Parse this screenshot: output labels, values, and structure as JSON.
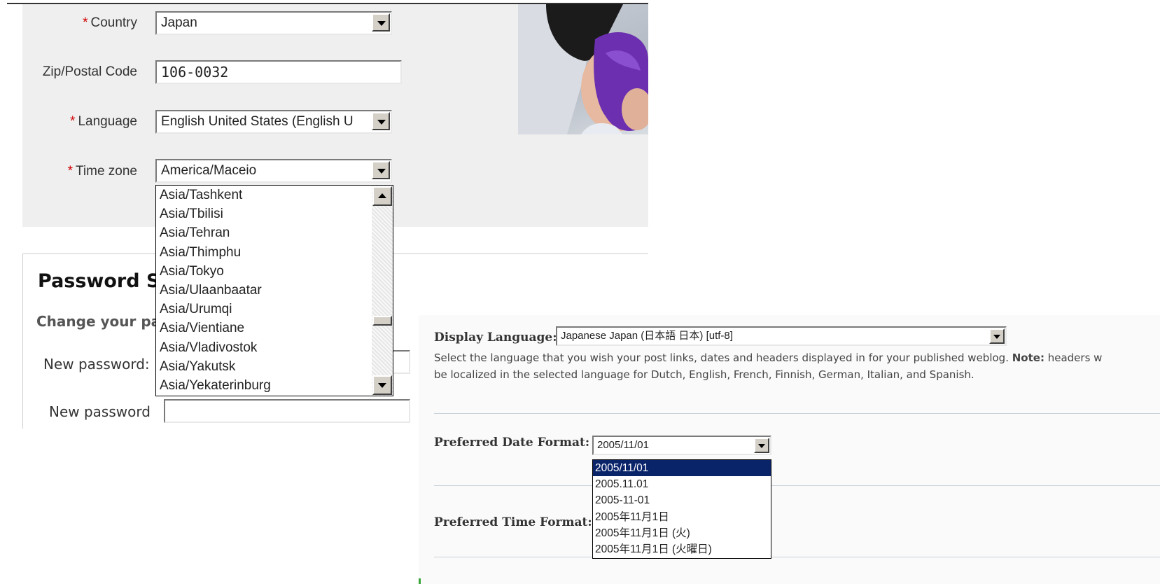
{
  "left": {
    "country": {
      "label": "Country",
      "value": "Japan"
    },
    "zip": {
      "label": "Zip/Postal Code",
      "value": "106-0032"
    },
    "language": {
      "label": "Language",
      "value": "English United States (English U"
    },
    "timezone": {
      "label": "Time zone",
      "value": "America/Maceio",
      "options": [
        "Asia/Tashkent",
        "Asia/Tbilisi",
        "Asia/Tehran",
        "Asia/Thimphu",
        "Asia/Tokyo",
        "Asia/Ulaanbaatar",
        "Asia/Urumqi",
        "Asia/Vientiane",
        "Asia/Vladivostok",
        "Asia/Yakutsk",
        "Asia/Yekaterinburg"
      ]
    },
    "required_mark": "*",
    "password": {
      "title": "Password Se",
      "subtitle": "Change your pa",
      "new_password_label": "New password:",
      "confirm_label": "New password"
    }
  },
  "right": {
    "display_language": {
      "label": "Display Language:",
      "value": "Japanese Japan (日本語 日本) [utf-8]",
      "help_1": "Select the language that you wish your post links, dates and headers displayed in for your published weblog.",
      "note_label": "Note:",
      "help_1b": "headers w",
      "help_2": "be localized in the selected language for Dutch, English, French, Finnish, German, Italian, and Spanish."
    },
    "date_format": {
      "label": "Preferred Date Format:",
      "value": "2005/11/01",
      "options": [
        "2005/11/01",
        "2005.11.01",
        "2005-11-01",
        "2005年11月1日",
        "2005年11月1日 (火)",
        "2005年11月1日 (火曜日)"
      ],
      "selected_index": 0
    },
    "time_format": {
      "label": "Preferred Time Format:"
    }
  },
  "colors": {
    "required": "#d00000",
    "selection": "#0a246a",
    "panel_grey": "#efefef"
  },
  "icons": [
    "dropdown-arrow-icon",
    "scroll-up-icon",
    "scroll-down-icon"
  ]
}
